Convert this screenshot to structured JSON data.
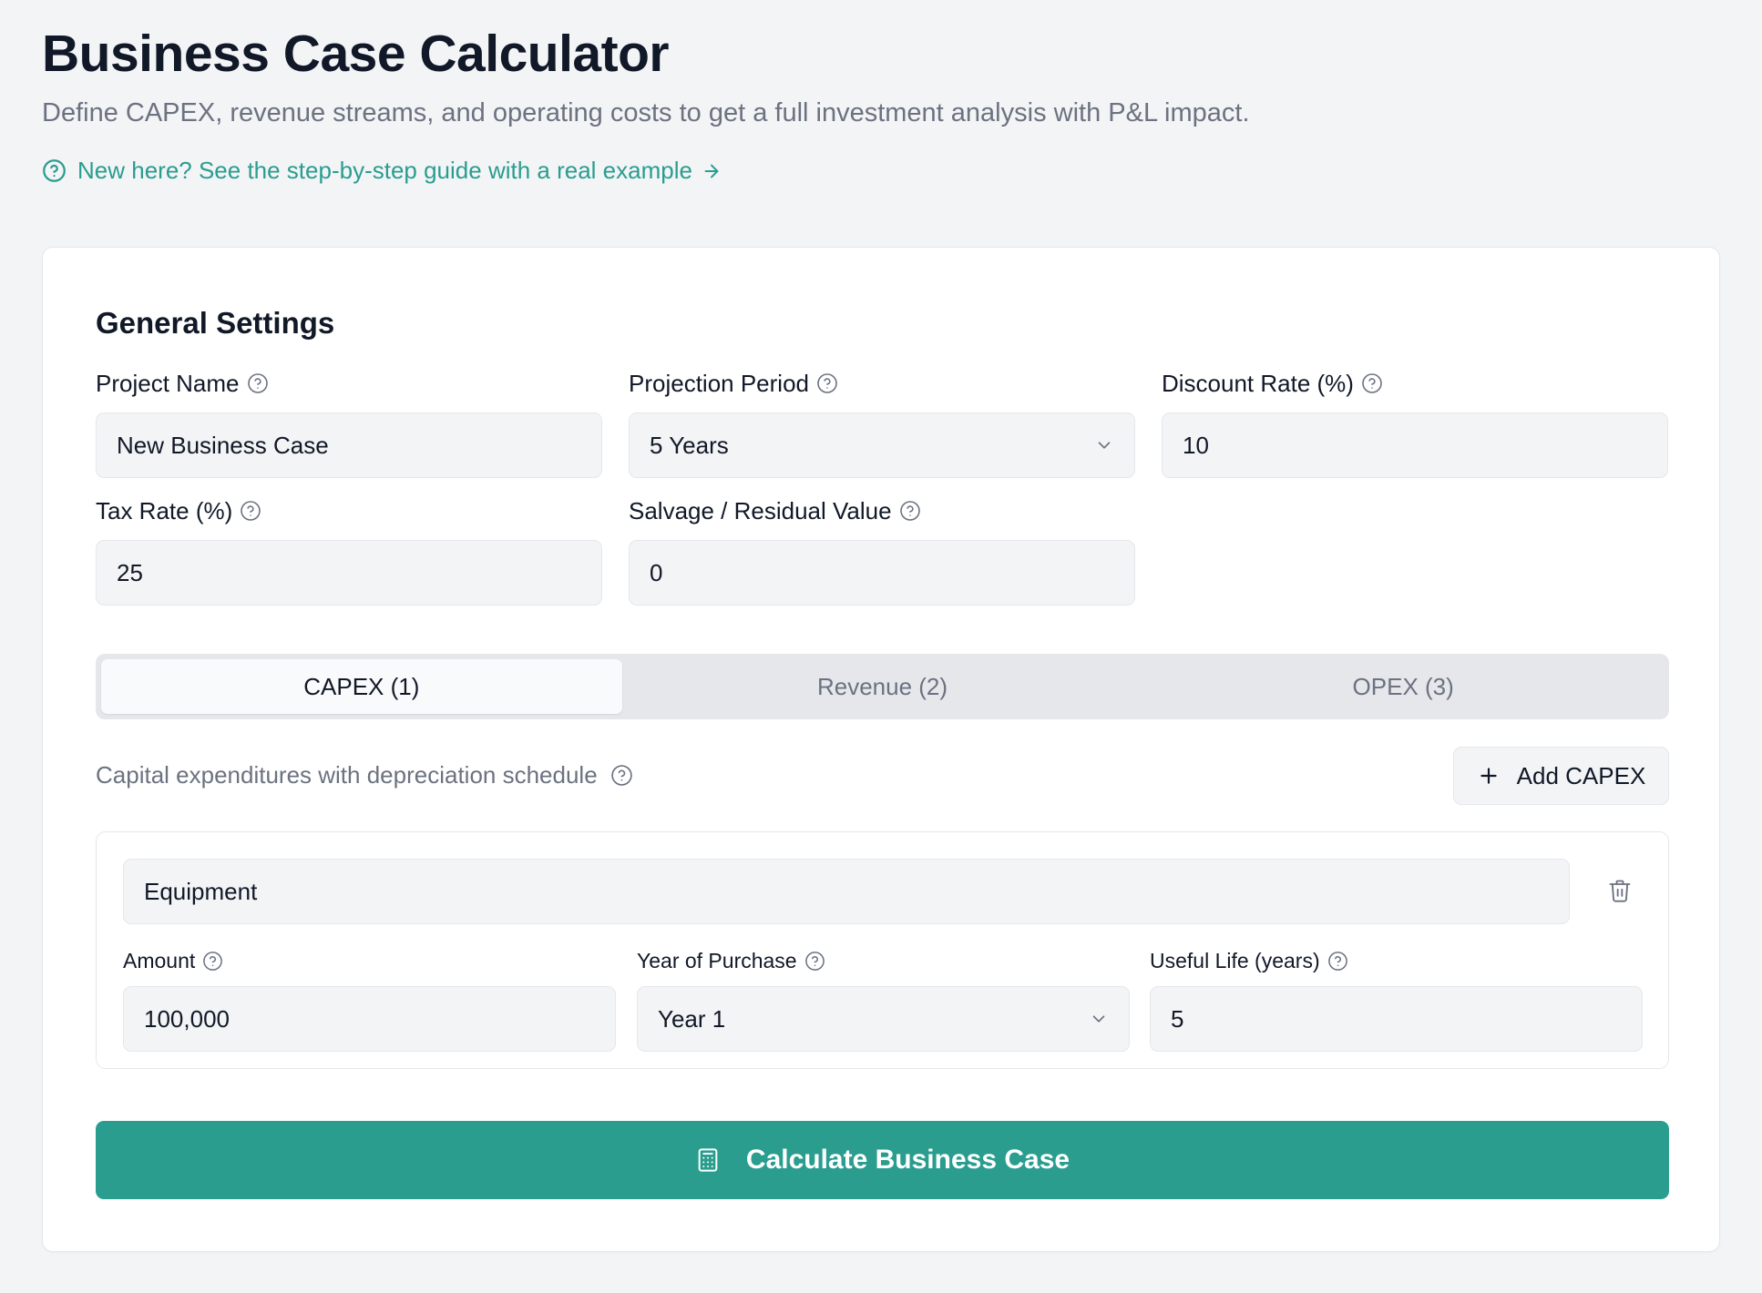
{
  "header": {
    "title": "Business Case Calculator",
    "subtitle": "Define CAPEX, revenue streams, and operating costs to get a full investment analysis with P&L impact.",
    "guide_link": "New here? See the step-by-step guide with a real example"
  },
  "general": {
    "section_title": "General Settings",
    "project_name": {
      "label": "Project Name",
      "value": "New Business Case"
    },
    "projection_period": {
      "label": "Projection Period",
      "value": "5 Years"
    },
    "discount_rate": {
      "label": "Discount Rate (%)",
      "value": "10"
    },
    "tax_rate": {
      "label": "Tax Rate (%)",
      "value": "25"
    },
    "salvage": {
      "label": "Salvage / Residual Value",
      "value": "0"
    }
  },
  "tabs": [
    {
      "label": "CAPEX (1)",
      "active": true
    },
    {
      "label": "Revenue (2)",
      "active": false
    },
    {
      "label": "OPEX (3)",
      "active": false
    }
  ],
  "capex": {
    "description": "Capital expenditures with depreciation schedule",
    "add_label": "Add CAPEX",
    "items": [
      {
        "name": "Equipment",
        "amount": {
          "label": "Amount",
          "value": "100,000"
        },
        "year": {
          "label": "Year of Purchase",
          "value": "Year 1"
        },
        "life": {
          "label": "Useful Life (years)",
          "value": "5"
        }
      }
    ]
  },
  "calculate_label": "Calculate Business Case",
  "colors": {
    "accent": "#2a9d8f",
    "background": "#f3f4f6",
    "card": "#ffffff",
    "muted_text": "#6b7280"
  },
  "icons": {
    "help": "help-circle-icon",
    "arrow": "arrow-right-icon",
    "chevron": "chevron-down-icon",
    "plus": "plus-icon",
    "trash": "trash-icon",
    "calculator": "calculator-icon"
  }
}
